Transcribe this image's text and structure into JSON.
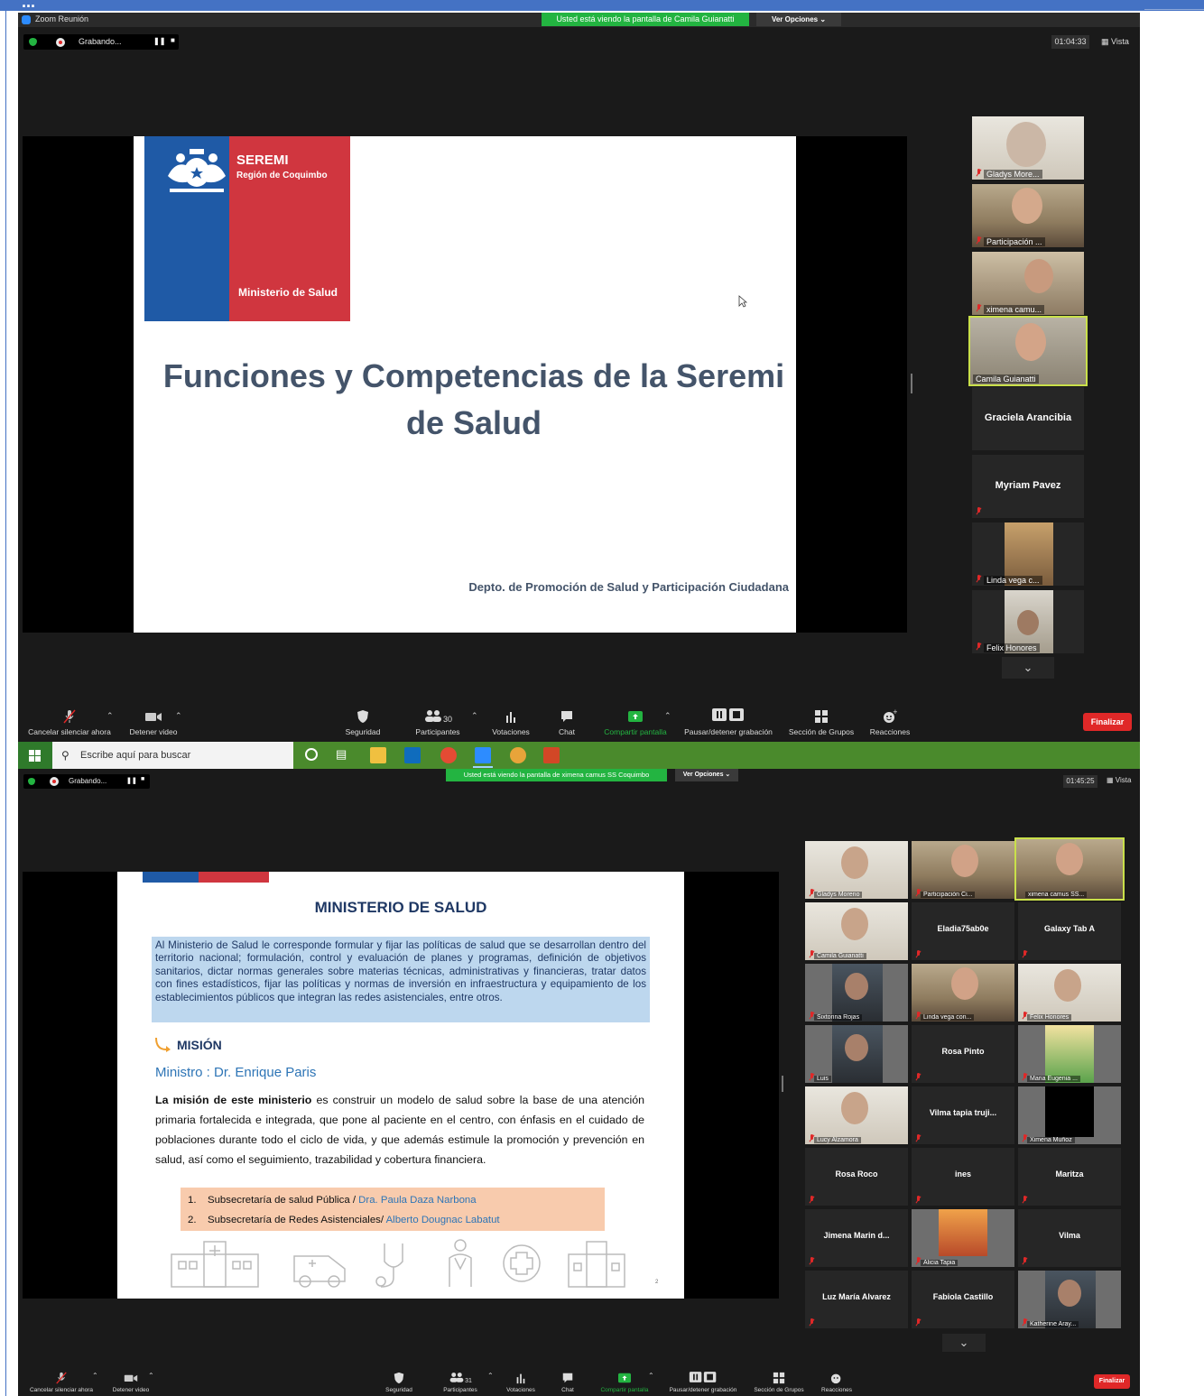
{
  "doc_header": {
    "label": "... "
  },
  "window1": {
    "title": "Zoom Reunión",
    "viewing_banner": "Usted está viendo la pantalla de Camila Guianatti",
    "view_options": "Ver Opciones",
    "recording_label": "Grabando...",
    "timer": "01:04:33",
    "view_label": "Vista",
    "slide": {
      "logo_title": "SEREMI",
      "logo_region": "Región de Coquimbo",
      "logo_ministry": "Ministerio de Salud",
      "title": "Funciones y Competencias de la Seremi de Salud",
      "department": "Depto. de Promoción de Salud y Participación Ciudadana"
    },
    "participants": [
      {
        "name": "Gladys More..."
      },
      {
        "name": "Participación ..."
      },
      {
        "name": "ximena camu..."
      },
      {
        "name": "Camila Guianatti"
      },
      {
        "name": "Graciela Arancibia"
      },
      {
        "name": "Myriam Pavez"
      },
      {
        "name": "Linda vega c..."
      },
      {
        "name": "Felix Honores"
      }
    ],
    "toolbar": {
      "mute": "Cancelar silenciar ahora",
      "video": "Detener video",
      "security": "Seguridad",
      "participants": "Participantes",
      "participants_count": "30",
      "polls": "Votaciones",
      "chat": "Chat",
      "share": "Compartir pantalla",
      "recording": "Pausar/detener grabación",
      "rooms": "Sección de Grupos",
      "reactions": "Reacciones",
      "end": "Finalizar"
    }
  },
  "taskbar": {
    "search_placeholder": "Escribe aquí para buscar"
  },
  "window2": {
    "viewing_banner": "Usted está viendo la pantalla de ximena camus SS Coquimbo",
    "view_options": "Ver Opciones",
    "recording_label": "Grabando...",
    "timer": "01:45:25",
    "view_label": "Vista",
    "slide": {
      "title": "MINISTERIO DE SALUD",
      "intro": "Al Ministerio de Salud le corresponde formular y fijar las políticas de salud que se desarrollan dentro del territorio nacional; formulación, control y evaluación de planes y programas, definición de objetivos sanitarios, dictar normas generales sobre materias técnicas, administrativas y financieras, tratar datos con fines estadísticos, fijar las políticas y normas de inversión en infraestructura y equipamiento de los establecimientos públicos que integran las redes asistenciales, entre otros.",
      "mision_heading": "MISIÓN",
      "minister": "Ministro : Dr. Enrique Paris",
      "mision_lead": "La misión de este ministerio",
      "mision_text": " es construir un modelo de salud sobre la base de una atención primaria fortalecida e integrada, que pone al paciente en el centro, con énfasis en el cuidado de poblaciones durante todo el ciclo de vida, y que además estimule la promoción y prevención en salud, así como el seguimiento, trazabilidad y cobertura financiera.",
      "sub1_num": "1.",
      "sub1_label": "Subsecretaría de salud Pública / ",
      "sub1_person": "Dra. Paula Daza Narbona",
      "sub2_num": "2.",
      "sub2_label": "Subsecretaría de Redes Asistenciales/ ",
      "sub2_person": "Alberto Dougnac Labatut",
      "page": "2"
    },
    "participants": [
      {
        "name": "Gladys Moreno"
      },
      {
        "name": "Participación Ci..."
      },
      {
        "name": "ximena camus SS..."
      },
      {
        "name": "Camila Guianatti"
      },
      {
        "name": "Eladia75ab0e"
      },
      {
        "name": "Galaxy Tab A"
      },
      {
        "name": "Sixtorina Rojas"
      },
      {
        "name": "Linda vega con..."
      },
      {
        "name": "Felix Honores"
      },
      {
        "name": "Luis"
      },
      {
        "name": "Rosa Pinto"
      },
      {
        "name": "Maria Eugenia ..."
      },
      {
        "name": "Lucy Alzamora"
      },
      {
        "name": "Vilma tapia truji..."
      },
      {
        "name": "Ximena Muñoz"
      },
      {
        "name": "Rosa Roco"
      },
      {
        "name": "ines"
      },
      {
        "name": "Maritza"
      },
      {
        "name": "Jimena Marin d..."
      },
      {
        "name": "Alicia Tapia"
      },
      {
        "name": "Vilma"
      },
      {
        "name": "Luz María Alvarez"
      },
      {
        "name": "Fabiola Castillo"
      },
      {
        "name": "Katherine Aray..."
      }
    ],
    "toolbar": {
      "mute": "Cancelar silenciar ahora",
      "video": "Detener video",
      "security": "Seguridad",
      "participants": "Participantes",
      "participants_count": "31",
      "polls": "Votaciones",
      "chat": "Chat",
      "share": "Compartir pantalla",
      "recording": "Pausar/detener grabación",
      "rooms": "Sección de Grupos",
      "reactions": "Reacciones",
      "end": "Finalizar"
    }
  },
  "colors": {
    "zoom_green": "#23b441",
    "end_red": "#e02828",
    "seremi_blue": "#1f5aa6",
    "seremi_red": "#d0363f",
    "slide_title": "#44546a"
  }
}
